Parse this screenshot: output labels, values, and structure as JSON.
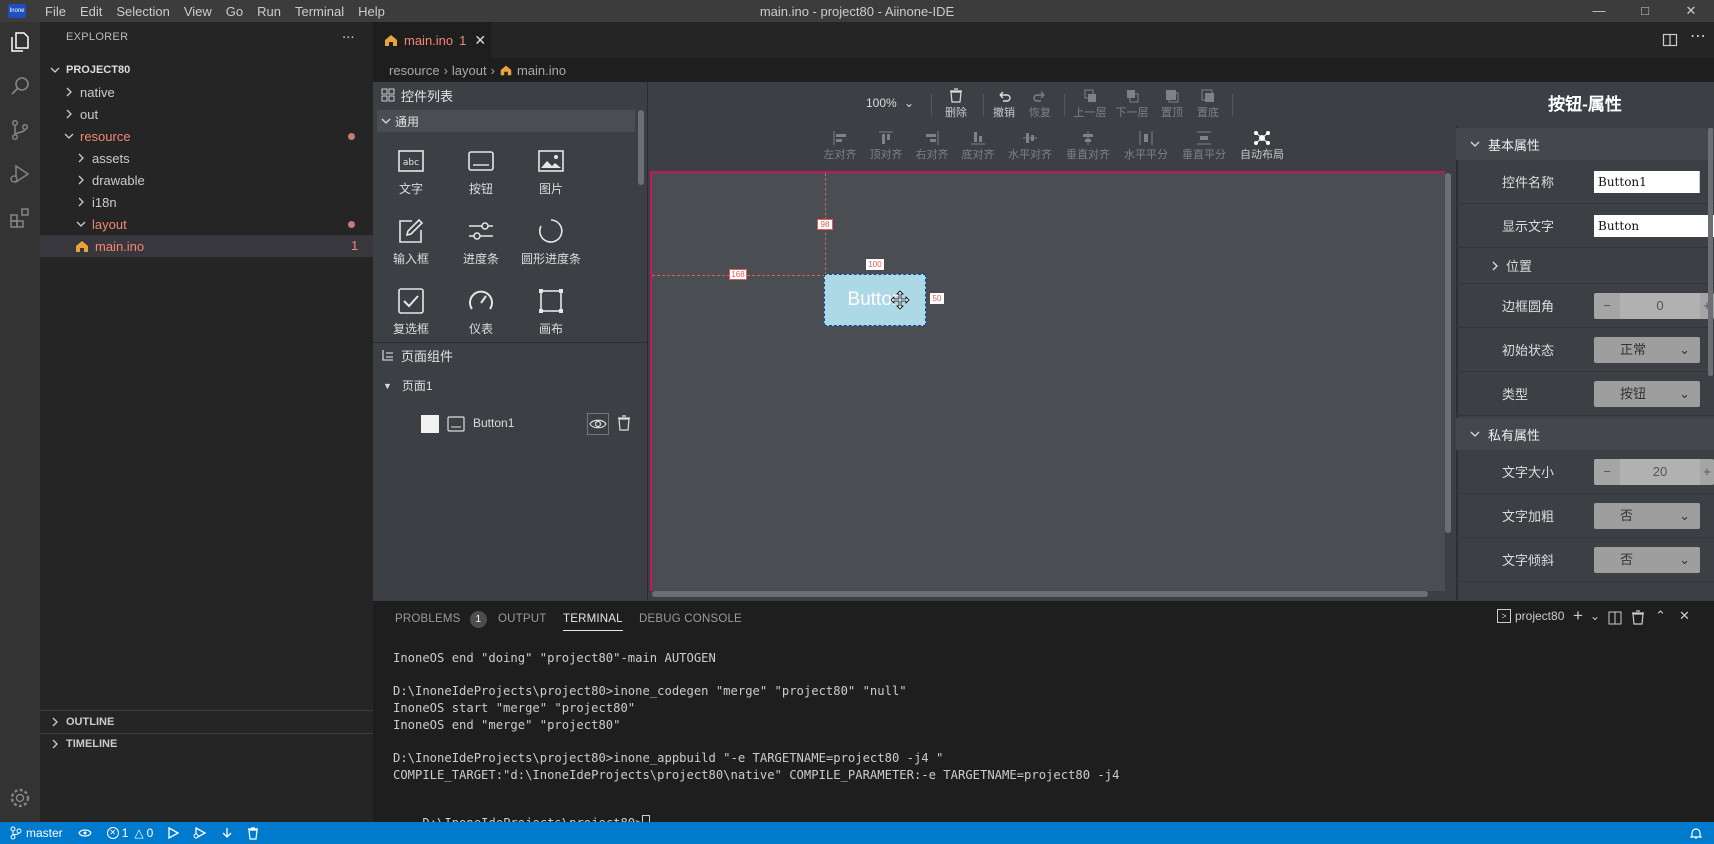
{
  "titlebar": {
    "logo": "Inone",
    "menu": [
      "File",
      "Edit",
      "Selection",
      "View",
      "Go",
      "Run",
      "Terminal",
      "Help"
    ],
    "title": "main.ino - project80 - Aiinone-IDE"
  },
  "explorer": {
    "header": "EXPLORER",
    "more": "...",
    "project": "PROJECT80",
    "items": [
      {
        "label": "native"
      },
      {
        "label": "out"
      },
      {
        "label": "resource"
      },
      {
        "label": "assets"
      },
      {
        "label": "drawable"
      },
      {
        "label": "i18n"
      },
      {
        "label": "layout"
      },
      {
        "label": "main.ino",
        "badge": "1"
      }
    ],
    "outline": "OUTLINE",
    "timeline": "TIMELINE"
  },
  "tab": {
    "label": "main.ino",
    "badge": "1"
  },
  "breadcrumb": [
    "resource",
    "layout",
    "main.ino"
  ],
  "palette": {
    "title": "控件列表",
    "group": "通用",
    "items": [
      {
        "label": "文字",
        "icon": "text-icon"
      },
      {
        "label": "按钮",
        "icon": "button-icon"
      },
      {
        "label": "图片",
        "icon": "image-icon"
      },
      {
        "label": "输入框",
        "icon": "edit-icon"
      },
      {
        "label": "进度条",
        "icon": "slider-icon"
      },
      {
        "label": "圆形进度条",
        "icon": "arc-icon"
      },
      {
        "label": "复选框",
        "icon": "checkbox-icon"
      },
      {
        "label": "仪表",
        "icon": "gauge-icon"
      },
      {
        "label": "画布",
        "icon": "canvas-icon"
      }
    ],
    "text_icon_glyph": "abc"
  },
  "page_components": {
    "title": "页面组件",
    "page": "页面1",
    "component": "Button1"
  },
  "toolbar": {
    "zoom": "100%",
    "delete": "删除",
    "undo": "撤销",
    "redo": "恢复",
    "up": "上一层",
    "down": "下一层",
    "top": "置顶",
    "bottom": "置底",
    "align_left": "左对齐",
    "align_top": "顶对齐",
    "align_right": "右对齐",
    "align_bottom": "底对齐",
    "align_hcenter": "水平对齐",
    "align_vcenter": "垂直对齐",
    "dist_h": "水平平分",
    "dist_v": "垂直平分",
    "auto_layout": "自动布局"
  },
  "canvas": {
    "button_text": "Button",
    "dim_top": "98",
    "dim_left": "168",
    "dim_width": "100",
    "dim_height": "50"
  },
  "props": {
    "title": "按钮-属性",
    "basic": "基本属性",
    "name_label": "控件名称",
    "name_value": "Button1",
    "text_label": "显示文字",
    "text_value": "Button",
    "position": "位置",
    "radius_label": "边框圆角",
    "radius_value": "0",
    "state_label": "初始状态",
    "state_value": "正常",
    "type_label": "类型",
    "type_value": "按钮",
    "private": "私有属性",
    "fontsize_label": "文字大小",
    "fontsize_value": "20",
    "bold_label": "文字加粗",
    "bold_value": "否",
    "italic_label": "文字倾斜",
    "italic_value": "否",
    "minus": "−",
    "plus": "+"
  },
  "panel": {
    "tabs": [
      {
        "label": "PROBLEMS",
        "badge": "1"
      },
      {
        "label": "OUTPUT"
      },
      {
        "label": "TERMINAL"
      },
      {
        "label": "DEBUG CONSOLE"
      }
    ],
    "terminal_name": "project80",
    "lines": [
      "InoneOS end \"doing\" \"project80\"-main AUTOGEN",
      "",
      "D:\\InoneIdeProjects\\project80>inone_codegen \"merge\" \"project80\" \"null\"",
      "InoneOS start \"merge\" \"project80\"",
      "InoneOS end \"merge\" \"project80\"",
      "",
      "D:\\InoneIdeProjects\\project80>inone_appbuild \"-e TARGETNAME=project80 -j4 \"",
      "COMPILE_TARGET:\"d:\\InoneIdeProjects\\project80\\native\" COMPILE_PARAMETER:-e TARGETNAME=project80 -j4",
      "",
      "D:\\InoneIdeProjects\\project80>"
    ]
  },
  "statusbar": {
    "branch": "master",
    "errors": "1",
    "warnings": "0"
  },
  "colors": {
    "accent": "#007acc",
    "modified": "#f48771",
    "canvas_border": "#c2185b",
    "button_fill": "#add8e6"
  }
}
